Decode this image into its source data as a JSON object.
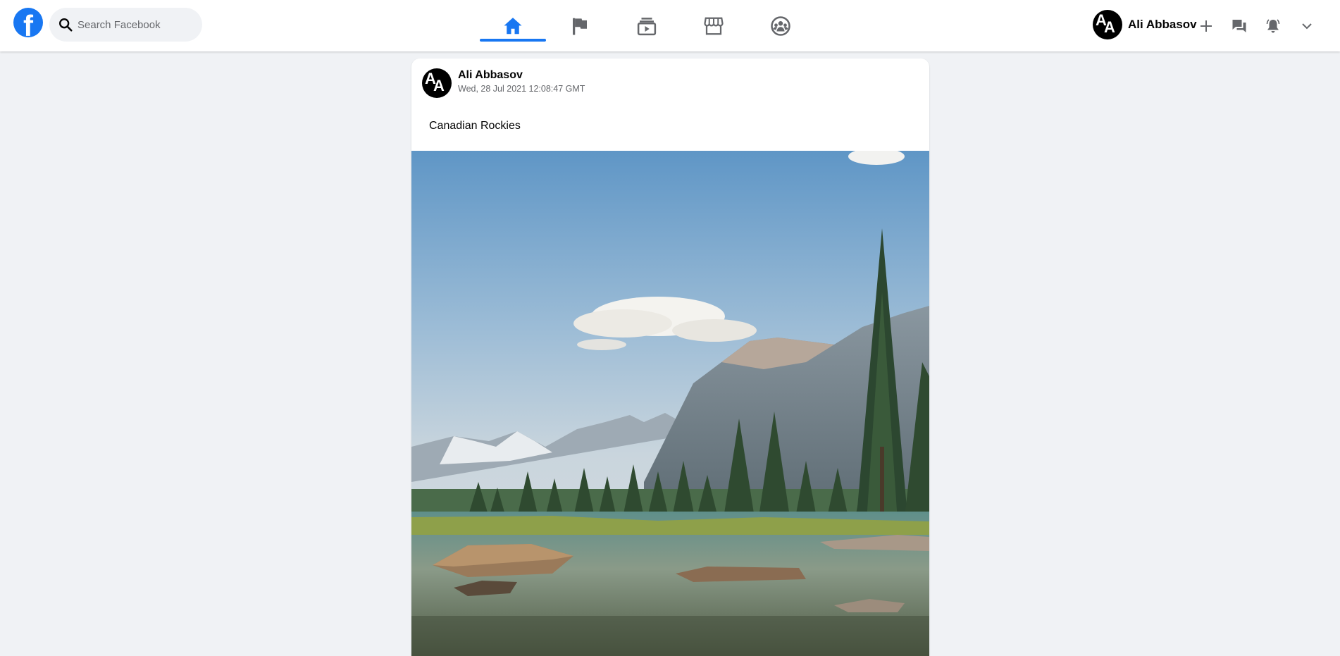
{
  "header": {
    "logo_letter": "f",
    "search": {
      "placeholder": "Search Facebook"
    },
    "tabs": [
      {
        "name": "home",
        "icon": "home-icon",
        "active": true
      },
      {
        "name": "pages",
        "icon": "flag-icon",
        "active": false
      },
      {
        "name": "watch",
        "icon": "video-icon",
        "active": false
      },
      {
        "name": "marketplace",
        "icon": "store-icon",
        "active": false
      },
      {
        "name": "groups",
        "icon": "groups-icon",
        "active": false
      }
    ],
    "profile": {
      "name": "Ali Abbasov",
      "initials_1": "A",
      "initials_2": "A"
    },
    "actions": [
      "plus-icon",
      "messenger-icon",
      "notifications-icon",
      "chevron-down-icon"
    ]
  },
  "post": {
    "author": "Ali Abbasov",
    "timestamp": "Wed, 28 Jul 2021 12:08:47 GMT",
    "text": "Canadian Rockies",
    "image_subject": "mountain lake with pine trees"
  },
  "colors": {
    "brand": "#1877f2",
    "background": "#f0f2f5",
    "icon": "#65676b",
    "text": "#050505"
  }
}
